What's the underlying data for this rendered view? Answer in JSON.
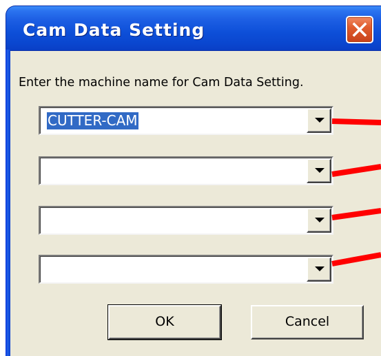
{
  "window": {
    "title": "Cam Data Setting",
    "close_icon": "close-icon"
  },
  "dialog": {
    "prompt": "Enter the machine name for Cam Data Setting.",
    "machine_fields": [
      {
        "value": "CUTTER-CAM",
        "selected": true
      },
      {
        "value": "",
        "selected": false
      },
      {
        "value": "",
        "selected": false
      },
      {
        "value": "",
        "selected": false
      }
    ],
    "ok_label": "OK",
    "cancel_label": "Cancel"
  },
  "colors": {
    "titlebar": "#0a4fd6",
    "client_background": "#ece9d8",
    "selection": "#316ac5",
    "close_button": "#e05d2e",
    "annotation_line": "#ff0000"
  }
}
